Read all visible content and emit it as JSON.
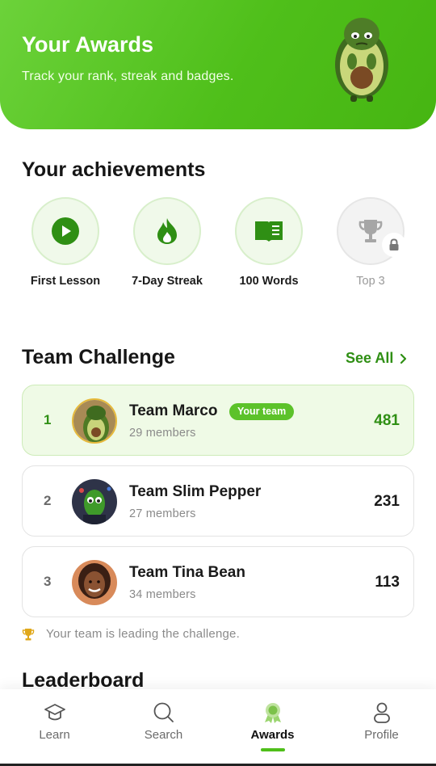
{
  "header": {
    "title": "Your Awards",
    "subtitle": "Track your rank, streak and badges."
  },
  "achievements": {
    "title": "Your achievements",
    "badges": [
      {
        "label": "First Lesson",
        "icon": "play-icon",
        "locked": false
      },
      {
        "label": "7-Day Streak",
        "icon": "flame-icon",
        "locked": false
      },
      {
        "label": "100 Words",
        "icon": "book-icon",
        "locked": false
      },
      {
        "label": "Top 3",
        "icon": "trophy-icon",
        "locked": true
      }
    ]
  },
  "team_challenge": {
    "title": "Team Challenge",
    "see_all": "See All",
    "your_team_tag": "Your team",
    "teams": [
      {
        "rank": "1",
        "name": "Team Marco",
        "members": "29 members",
        "score": "481",
        "mine": true
      },
      {
        "rank": "2",
        "name": "Team Slim Pepper",
        "members": "27 members",
        "score": "231",
        "mine": false
      },
      {
        "rank": "3",
        "name": "Team Tina Bean",
        "members": "34 members",
        "score": "113",
        "mine": false
      }
    ],
    "note": "Your team is leading the challenge."
  },
  "leaderboard": {
    "title": "Leaderboard"
  },
  "nav": {
    "items": [
      {
        "label": "Learn",
        "icon": "graduation-cap-icon",
        "active": false
      },
      {
        "label": "Search",
        "icon": "search-icon",
        "active": false
      },
      {
        "label": "Awards",
        "icon": "award-icon",
        "active": true
      },
      {
        "label": "Profile",
        "icon": "user-icon",
        "active": false
      }
    ]
  },
  "colors": {
    "brand_green": "#4fbf1a",
    "dark_green": "#2f8f14",
    "light_green_bg": "#effae6"
  }
}
